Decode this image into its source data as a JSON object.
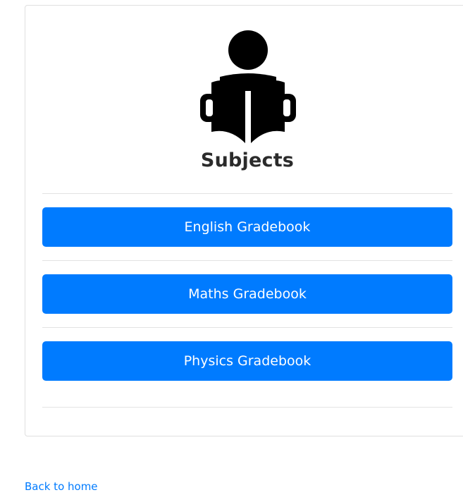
{
  "card": {
    "icon": "reading-person-icon",
    "title": "Subjects"
  },
  "subjects": [
    {
      "label": "English Gradebook"
    },
    {
      "label": "Maths Gradebook"
    },
    {
      "label": "Physics Gradebook"
    }
  ],
  "footer": {
    "back_link": "Back to home"
  },
  "colors": {
    "button": "#007bff",
    "link": "#007bff",
    "title": "#2b2b2b"
  }
}
